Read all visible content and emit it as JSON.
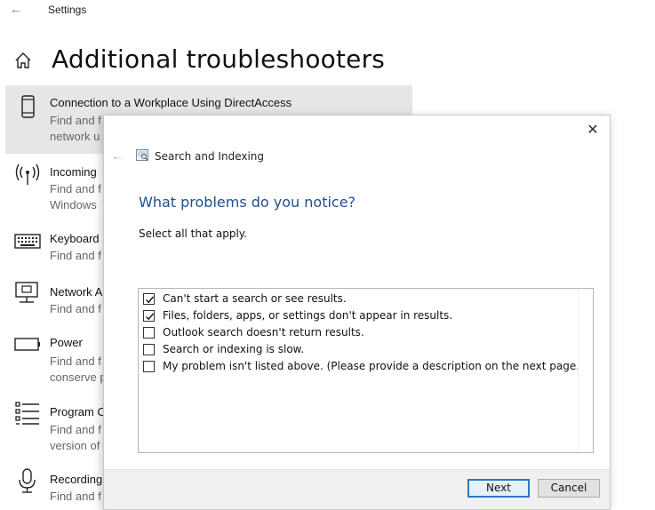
{
  "window": {
    "title": "Settings"
  },
  "page": {
    "title": "Additional troubleshooters"
  },
  "troubleshooters": [
    {
      "name": "Connection to a Workplace Using DirectAccess",
      "desc1": "Find and f",
      "desc2": "network u",
      "icon": "phone-icon"
    },
    {
      "name": "Incoming",
      "desc1": "Find and f",
      "desc2": "Windows",
      "icon": "wireless-icon"
    },
    {
      "name": "Keyboard",
      "desc1": "Find and f",
      "desc2": "",
      "icon": "keyboard-icon"
    },
    {
      "name": "Network A",
      "desc1": "Find and f",
      "desc2": "",
      "icon": "network-adapter-icon"
    },
    {
      "name": "Power",
      "desc1": "Find and f",
      "desc2": "conserve p",
      "icon": "battery-icon"
    },
    {
      "name": "Program C",
      "desc1": "Find and f",
      "desc2": "version of",
      "icon": "program-list-icon"
    },
    {
      "name": "Recording",
      "desc1": "Find and f",
      "desc2": "",
      "icon": "microphone-icon"
    }
  ],
  "dialog": {
    "app_name": "Search and Indexing",
    "heading": "What problems do you notice?",
    "instruction": "Select all that apply.",
    "options": [
      {
        "label": "Can't start a search or see results.",
        "checked": true
      },
      {
        "label": "Files, folders, apps, or settings don't appear in results.",
        "checked": true
      },
      {
        "label": "Outlook search doesn't return results.",
        "checked": false
      },
      {
        "label": "Search or indexing is slow.",
        "checked": false
      },
      {
        "label": "My problem isn't listed above. (Please provide a description on the next page.)",
        "checked": false
      }
    ],
    "next_label": "Next",
    "cancel_label": "Cancel",
    "close_glyph": "✕",
    "back_glyph": "←"
  },
  "colors": {
    "heading_blue": "#1f4f8f",
    "selection_gray": "#e6e6e6",
    "primary_border": "#2e74c6"
  }
}
